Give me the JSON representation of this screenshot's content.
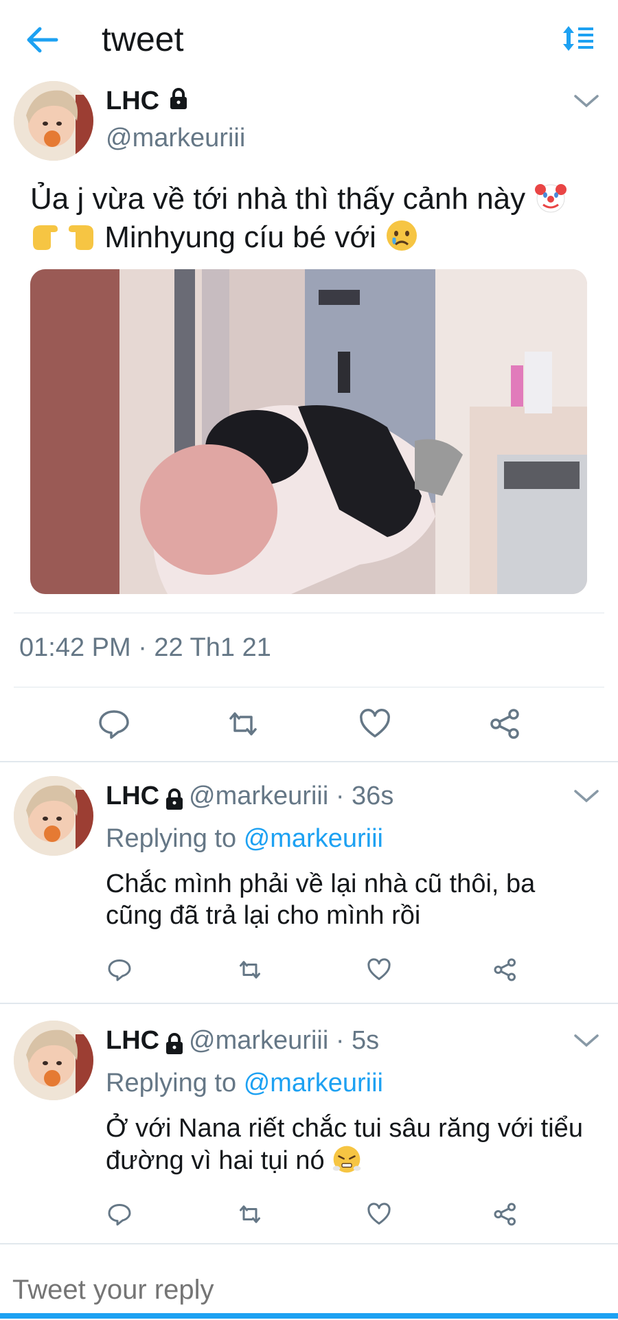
{
  "header": {
    "title": "tweet",
    "back_icon": "arrow-left-icon",
    "sort_icon": "sort-list-icon",
    "accent": "#1DA1F2"
  },
  "main_tweet": {
    "name": "LHC",
    "handle": "@markeuriii",
    "text_line1": "Ủa j vừa về tới nhà thì thấy cảnh này",
    "text_line2": "Minhyung cíu bé với",
    "emojis": [
      "clown-face-emoji",
      "pointing-hands-emoji",
      "crying-face-emoji"
    ],
    "timestamp": "01:42 PM · 22 Th1 21",
    "actions": [
      "reply-icon",
      "retweet-icon",
      "like-icon",
      "share-icon"
    ]
  },
  "replies": [
    {
      "name": "LHC",
      "handle_time": "@markeuriii · 36s",
      "replying_prefix": "Replying to",
      "replying_to": "@markeuriii",
      "text_line1": "Chắc mình phải về lại nhà cũ thôi, ba",
      "text_line2": "cũng đã trả lại cho mình rồi"
    },
    {
      "name": "LHC",
      "handle_time": "@markeuriii · 5s",
      "replying_prefix": "Replying to",
      "replying_to": "@markeuriii",
      "text_line1": "Ở với Nana riết chắc tui sâu răng với tiểu",
      "text_line2": "đường vì hai tụi nó",
      "emoji": "face-with-steam-emoji"
    }
  ],
  "compose": {
    "placeholder": "Tweet your reply"
  }
}
